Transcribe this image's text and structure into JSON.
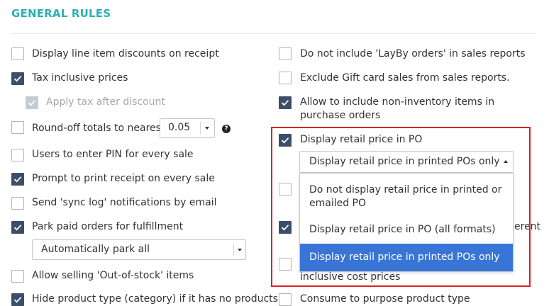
{
  "section": {
    "title": "GENERAL RULES"
  },
  "left": {
    "display_line_discounts": {
      "label": "Display line item discounts on receipt",
      "checked": false
    },
    "tax_inclusive": {
      "label": "Tax inclusive prices",
      "checked": true
    },
    "apply_tax_after_discount": {
      "label": "Apply tax after discount",
      "checked": true,
      "disabled": true
    },
    "round_off": {
      "label": "Round-off totals to nearest",
      "checked": false,
      "value": "0.05"
    },
    "users_pin": {
      "label": "Users to enter PIN for every sale",
      "checked": false
    },
    "prompt_receipt": {
      "label": "Prompt to print receipt on every sale",
      "checked": true
    },
    "sync_log": {
      "label": "Send 'sync log' notifications by email",
      "checked": false
    },
    "park_orders": {
      "label": "Park paid orders for fulfillment",
      "checked": true,
      "option": "Automatically park all"
    },
    "out_of_stock": {
      "label": "Allow selling 'Out-of-stock' items",
      "checked": false
    },
    "hide_product_type": {
      "label": "Hide product type (category) if it has no products",
      "checked": true
    }
  },
  "right": {
    "layby": {
      "label": "Do not include 'LayBy orders' in sales reports",
      "checked": false
    },
    "gift_card": {
      "label": "Exclude Gift card sales from sales reports.",
      "checked": false
    },
    "non_inventory": {
      "label": "Allow to include non-inventory items in purchase orders",
      "checked": true
    },
    "display_retail": {
      "label": "Display retail price in PO",
      "checked": true,
      "selected": "Display retail price in printed POs only"
    },
    "hidden_row_1": {
      "checked": false
    },
    "hidden_row_2": {
      "checked": true,
      "label_tail": "erent"
    },
    "hidden_row_3": {
      "checked": false,
      "label_tail": "inclusive cost prices"
    },
    "bottom_row": {
      "checked": false,
      "label": "Consume to purpose product type"
    }
  },
  "dropdown": {
    "options": [
      "Do not display retail price in printed or emailed PO",
      "Display retail price in PO (all formats)",
      "Display retail price in printed POs only"
    ],
    "selected_index": 2
  },
  "colors": {
    "accent": "#2bb0b3",
    "checkbox_checked": "#3d4e6a",
    "highlight_border": "#d9231f",
    "option_selected": "#3875d7"
  }
}
